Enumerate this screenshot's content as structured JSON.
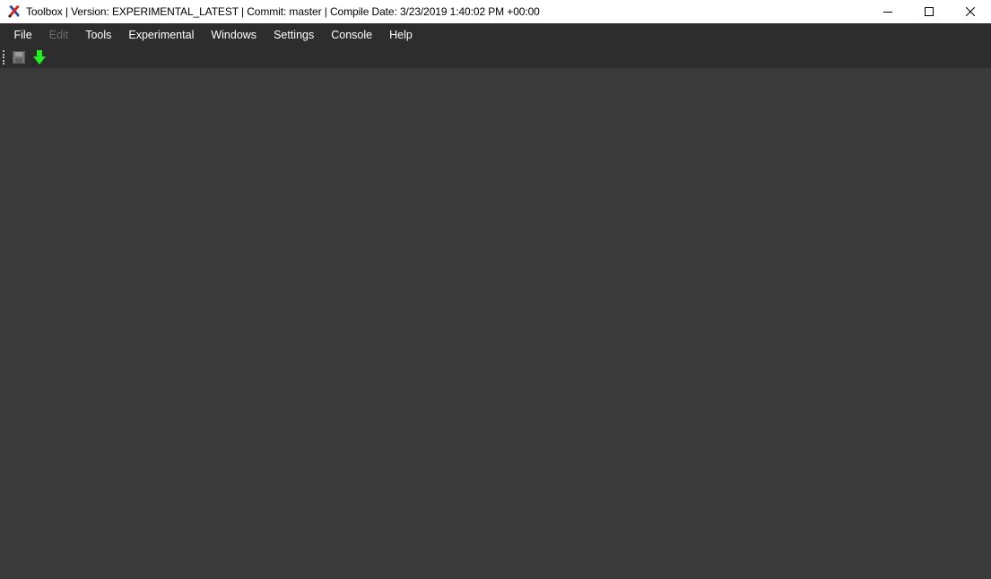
{
  "window": {
    "title": "Toolbox | Version: EXPERIMENTAL_LATEST | Commit: master | Compile Date: 3/23/2019 1:40:02 PM +00:00",
    "icon": "toolbox-app-icon",
    "controls": [
      "minimize-icon",
      "maximize-icon",
      "close-icon"
    ]
  },
  "menubar": {
    "items": [
      {
        "label": "File",
        "enabled": true
      },
      {
        "label": "Edit",
        "enabled": false
      },
      {
        "label": "Tools",
        "enabled": true
      },
      {
        "label": "Experimental",
        "enabled": true
      },
      {
        "label": "Windows",
        "enabled": true
      },
      {
        "label": "Settings",
        "enabled": true
      },
      {
        "label": "Console",
        "enabled": true
      },
      {
        "label": "Help",
        "enabled": true
      }
    ]
  },
  "toolbar": {
    "buttons": [
      {
        "icon": "save-icon",
        "enabled": false
      },
      {
        "icon": "download-arrow-icon",
        "enabled": true,
        "color": "#22ee22"
      }
    ]
  },
  "colors": {
    "titlebar_bg": "#ffffff",
    "menubar_bg": "#2d2d2d",
    "workspace_bg": "#3a3a3a",
    "menu_text": "#ffffff",
    "menu_text_disabled": "#6d6d6d"
  }
}
